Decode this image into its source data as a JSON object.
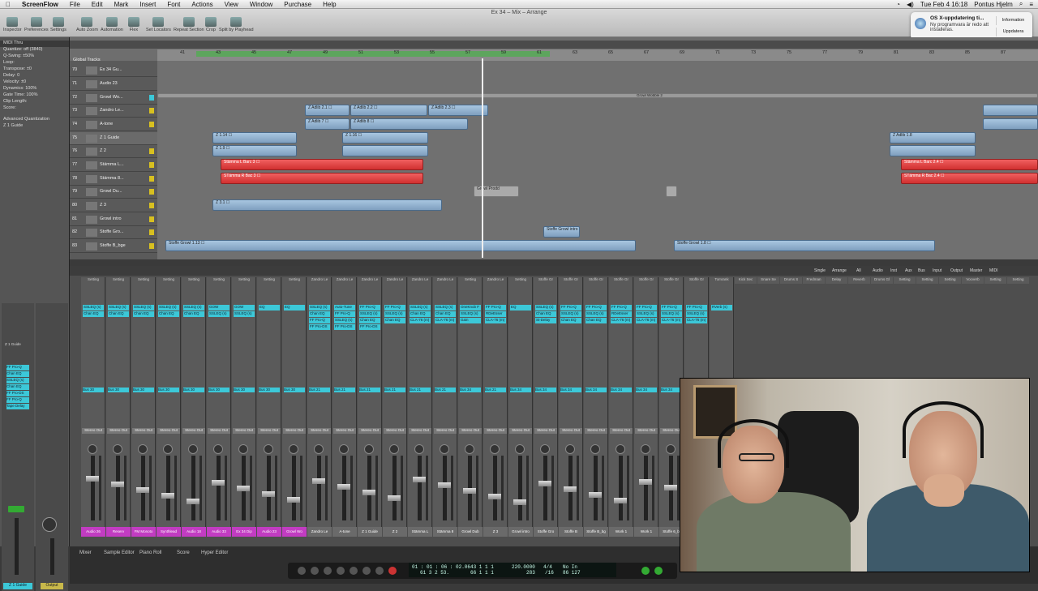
{
  "menubar": {
    "app": "ScreenFlow",
    "items": [
      "File",
      "Edit",
      "Mark",
      "Insert",
      "Font",
      "Actions",
      "View",
      "Window",
      "Purchase",
      "Help"
    ],
    "clock": "Tue Feb 4  16:18",
    "user": "Pontus Hjelm"
  },
  "window": {
    "title": "Ex 34 – Mix – Arrange"
  },
  "toolbar": [
    "Inspector",
    "Preferences",
    "Settings",
    "Auto Zoom",
    "Automation",
    "Flex",
    "Set Locators",
    "Repeat Section",
    "Crop",
    "Split by Playhead"
  ],
  "notification": {
    "title": "OS X-uppdatering ti...",
    "body": "Ny programvara är redo att installeras.",
    "btn_info": "Information",
    "btn_update": "Uppdatera"
  },
  "inspector": {
    "header": "MIDI Thru",
    "rows": [
      "Quantize: off (3840)",
      "Q-Swing: ±50%",
      "Loop:",
      "Transpose: ±0",
      "Delay: 0",
      "Velocity: ±0",
      "Dynamics: 100%",
      "Gate Time: 100%",
      "Clip Length:",
      "Score:"
    ],
    "sections": [
      "Advanced Quantization",
      "Z 1 Guide"
    ]
  },
  "ruler": {
    "label": "Global Tracks",
    "bars": [
      "41",
      "43",
      "45",
      "47",
      "49",
      "51",
      "53",
      "55",
      "57",
      "59",
      "61",
      "63",
      "65",
      "67",
      "69",
      "71",
      "73",
      "75",
      "77",
      "79",
      "81",
      "83",
      "85",
      "87",
      "89"
    ]
  },
  "tracks": [
    {
      "n": "70",
      "name": "Ex 34 Gu..."
    },
    {
      "n": "71",
      "name": "Audio 23"
    },
    {
      "n": "72",
      "name": "Growl Wo..."
    },
    {
      "n": "73",
      "name": "Zandro Le..."
    },
    {
      "n": "74",
      "name": "A-tone"
    },
    {
      "n": "75",
      "name": "Z 1 Guide"
    },
    {
      "n": "76",
      "name": "Z 2"
    },
    {
      "n": "77",
      "name": "Stämma L..."
    },
    {
      "n": "78",
      "name": "Stämma 8..."
    },
    {
      "n": "79",
      "name": "Growl Du..."
    },
    {
      "n": "80",
      "name": "Z 3"
    },
    {
      "n": "81",
      "name": "Growl intro"
    },
    {
      "n": "82",
      "name": "Stoffe Gro..."
    },
    {
      "n": "83",
      "name": "Stoffe B_bge"
    }
  ],
  "regions": {
    "r1": "Z Adlib 2.1 ☐",
    "r2": "Z Adlib 2.2 ☐",
    "r3": "Z Adlib 2.3 ☐",
    "r4": "Z Adlib 7 ☐",
    "r5": "Z Adlib 8 ☐",
    "r6": "Z 1.14 ☐",
    "r7": "Z 1.16 ☐",
    "r8": "Z 1.9 ☐",
    "r9": "Stämma L Barc 3 ☐",
    "r10": "STämma R Bac 3 ☐",
    "r11": "Z 3.1 ☐",
    "r12": "Growl Prodd",
    "r13": "Stoffe Growl intro",
    "r14": "Stoffe Growl 1.13 ☐",
    "r15": "Stoffe Growl 1.8 ☐",
    "r16": "Stämma L Barc 2.4 ☐",
    "r17": "STämma R Bac 2.4 ☐",
    "r18": "Z Adlib 1.8",
    "r19": "Growl Wobble 2"
  },
  "mixer": {
    "tabs": [
      "Single",
      "Arrange",
      "All",
      "Audio",
      "Inst",
      "Aux",
      "Bus",
      "Input",
      "Output",
      "Master",
      "MIDI"
    ],
    "strips": [
      {
        "name": "Audio 26",
        "hdr": "Setting",
        "ins": [
          "SSLEQ (s)",
          "Chan EQ"
        ],
        "bus": "Bus 30",
        "out": "Stereo Out",
        "c": "#c23cc2"
      },
      {
        "name": "Reserv",
        "hdr": "Setting",
        "ins": [
          "SSLEQ (s)",
          "Chan EQ"
        ],
        "bus": "Bus 30",
        "out": "Stereo Out",
        "c": "#c23cc2"
      },
      {
        "name": "FM Monoto",
        "hdr": "Setting",
        "ins": [
          "SSLEQ (s)",
          "Chan EQ"
        ],
        "bus": "Bus 30",
        "out": "Stereo Out",
        "c": "#c23cc2"
      },
      {
        "name": "Synthlead",
        "hdr": "Setting",
        "ins": [
          "SSLEQ (s)",
          "Chan EQ"
        ],
        "bus": "Bus 30",
        "out": "Stereo Out",
        "c": "#c23cc2"
      },
      {
        "name": "Audio 18",
        "hdr": "Setting",
        "ins": [
          "SSLEQ (s)",
          "Chan EQ"
        ],
        "bus": "Bus 30",
        "out": "Stereo Out",
        "c": "#c23cc2"
      },
      {
        "name": "Audio 33",
        "hdr": "Setting",
        "ins": [
          "GOW",
          "SSLEQ (s)"
        ],
        "bus": "Bus 30",
        "out": "Stereo Out",
        "c": "#c23cc2"
      },
      {
        "name": "Ex 34 Dip",
        "hdr": "Setting",
        "ins": [
          "GOW",
          "SSLEQ (s)"
        ],
        "bus": "Bus 30",
        "out": "Stereo Out",
        "c": "#c23cc2"
      },
      {
        "name": "Audio 23",
        "hdr": "Setting",
        "ins": [
          "EQ"
        ],
        "bus": "Bus 30",
        "out": "Stereo Out",
        "c": "#c23cc2"
      },
      {
        "name": "Growl Wo",
        "hdr": "Setting",
        "ins": [
          "EQ"
        ],
        "bus": "Bus 30",
        "out": "Stereo Out",
        "c": "#c23cc2"
      },
      {
        "name": "Zandro Le",
        "hdr": "Zandro Le",
        "ins": [
          "SSLEQ (s)",
          "Chan EQ",
          "FF Pro-Q",
          "FF Pro-DS"
        ],
        "bus": "Bus 21",
        "out": "Stereo Out",
        "c": "#6a6a6a"
      },
      {
        "name": "A-tone",
        "hdr": "Zandro Le",
        "ins": [
          "Auto-Tune",
          "FF Pro-Q",
          "SSLEQ (s)",
          "FF Pro-DS"
        ],
        "bus": "Bus 21",
        "out": "Stereo Out",
        "c": "#6a6a6a"
      },
      {
        "name": "Z 1 Guide",
        "hdr": "Zandro Le",
        "ins": [
          "FF Pro-Q",
          "SSLEQ (s)",
          "Chan EQ",
          "FF Pro-DS"
        ],
        "bus": "Bus 21",
        "out": "Stereo Out",
        "c": "#6a6a6a"
      },
      {
        "name": "Z 2",
        "hdr": "Zandro Le",
        "ins": [
          "FF Pro-Q",
          "SSLEQ (s)",
          "Chan EQ"
        ],
        "bus": "Bus 21",
        "out": "Stereo Out",
        "c": "#6a6a6a"
      },
      {
        "name": "Stämma L",
        "hdr": "Zandro Le",
        "ins": [
          "SSLEQ (s)",
          "Chan EQ",
          "CLA-76 (m)"
        ],
        "bus": "Bus 21",
        "out": "Stereo Out",
        "c": "#6a6a6a"
      },
      {
        "name": "Stämma 8",
        "hdr": "Zandro Le",
        "ins": [
          "SSLEQ (s)",
          "Chan EQ",
          "CLA-76 (m)"
        ],
        "bus": "Bus 21",
        "out": "Stereo Out",
        "c": "#6a6a6a"
      },
      {
        "name": "Growl Dub",
        "hdr": "Setting",
        "ins": [
          "OneKnob F",
          "SSLEQ (s)",
          "Gain"
        ],
        "bus": "Bus 34",
        "out": "Stereo Out",
        "c": "#6a6a6a"
      },
      {
        "name": "Z 3",
        "hdr": "Zandro Le",
        "ins": [
          "FF Pro-Q",
          "RDeEsser",
          "CLA-76 (m)"
        ],
        "bus": "Bus 21",
        "out": "Stereo Out",
        "c": "#6a6a6a"
      },
      {
        "name": "Growl intro",
        "hdr": "Setting",
        "ins": [
          "EQ"
        ],
        "bus": "Bus 34",
        "out": "Stereo Out",
        "c": "#6a6a6a"
      },
      {
        "name": "Stoffe Gro",
        "hdr": "Stoffe Gr",
        "ins": [
          "SSLEQ (s)",
          "Chan EQ",
          "St-Delay"
        ],
        "bus": "Bus 34",
        "out": "Stereo Out",
        "c": "#6a6a6a"
      },
      {
        "name": "Stoffe B",
        "hdr": "Stoffe Gr",
        "ins": [
          "FF Pro-Q",
          "SSLEQ (s)",
          "Chan EQ"
        ],
        "bus": "Bus 34",
        "out": "Stereo Out",
        "c": "#6a6a6a"
      },
      {
        "name": "Stoffe B_bg",
        "hdr": "Stoffe Gr",
        "ins": [
          "FF Pro-Q",
          "SSLEQ (s)",
          "Chan EQ"
        ],
        "bus": "Bus 34",
        "out": "Stereo Out",
        "c": "#6a6a6a"
      },
      {
        "name": "Work 1",
        "hdr": "Stoffe Gr",
        "ins": [
          "FF Pro-Q",
          "RDeEsser",
          "CLA-76 (m)"
        ],
        "bus": "Bus 34",
        "out": "Stereo Out",
        "c": "#6a6a6a"
      },
      {
        "name": "Work 1",
        "hdr": "Stoffe Gr",
        "ins": [
          "FF Pro-Q",
          "SSLEQ (s)",
          "CLA-76 (m)"
        ],
        "bus": "Bus 34",
        "out": "Stereo Out",
        "c": "#6a6a6a"
      },
      {
        "name": "Stoffe 6_bi",
        "hdr": "Stoffe Gr",
        "ins": [
          "FF Pro-Q",
          "SSLEQ (s)",
          "CLA-76 (m)"
        ],
        "bus": "Bus 34",
        "out": "Stereo Out",
        "c": "#6a6a6a"
      },
      {
        "name": "Stoffe 7_bl",
        "hdr": "Stoffe Gr",
        "ins": [
          "FF Pro-Q",
          "SSLEQ (s)",
          "CLA-76 (m)"
        ],
        "bus": "Bus 34",
        "out": "Stereo Out",
        "c": "#6a6a6a"
      },
      {
        "name": "Tomrank",
        "hdr": "Tomrank",
        "ins": [
          "RVerb (s)"
        ],
        "bus": "Bus 12",
        "out": "Bus 12",
        "c": "#c8b84a"
      }
    ],
    "extra_headers": [
      "Kick Sec",
      "Snare Se",
      "Drums S",
      "Fredman",
      "Delay",
      "Reverb",
      "Drums Gl",
      "Setting",
      "Setting",
      "Setting",
      "Vocverb",
      "Setting",
      "Setting"
    ]
  },
  "inspector_strip": {
    "name": "Z 1 Guide",
    "out": "Output",
    "inserts": [
      "FF Pro-Q",
      "Chan EQ",
      "SSLEQ (s)",
      "Chan EQ",
      "FF Pro-DS",
      "FF Pro-Q",
      "Tape Delay"
    ]
  },
  "bottom_tabs": [
    "Mixer",
    "Sample Editor",
    "Piano Roll",
    "Score",
    "Hyper Editor"
  ],
  "transport": {
    "position": "01 : 01 : 06 : 02.06",
    "bars": "61   3   2   53.",
    "bar1": "43   1   1   1",
    "bar2": "66   1   1   1",
    "tempo": "220.0000",
    "tempo2": "283",
    "sig": "4/4",
    "sig2": "/16",
    "in": "No In",
    "out": "No Out",
    "bpm2": "86 127"
  }
}
